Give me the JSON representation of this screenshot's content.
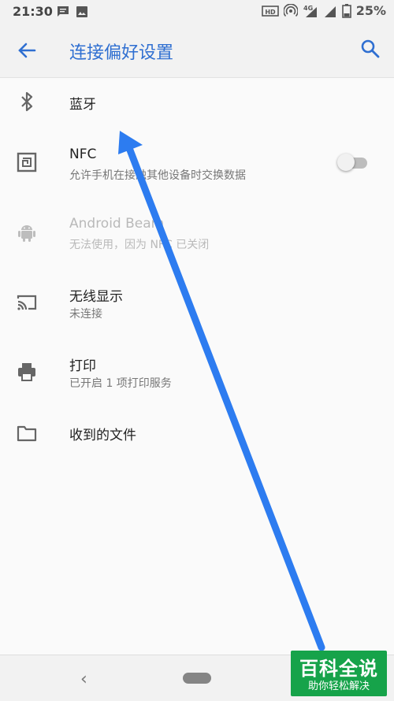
{
  "status_bar": {
    "time": "21:30",
    "left_icons": [
      "message-icon",
      "image-icon"
    ],
    "right_icons": [
      "hd-icon",
      "hotspot-icon",
      "signal-4g-icon",
      "signal-icon",
      "battery-icon"
    ],
    "network": "4G",
    "battery": "25%"
  },
  "app_bar": {
    "title": "连接偏好设置",
    "back_icon": "arrow-back-icon",
    "search_icon": "search-icon"
  },
  "items": [
    {
      "icon": "bluetooth-icon",
      "title": "蓝牙",
      "subtitle": ""
    },
    {
      "icon": "nfc-icon",
      "title": "NFC",
      "subtitle": "允许手机在接触其他设备时交换数据",
      "toggle": false
    },
    {
      "icon": "android-icon",
      "title": "Android Beam",
      "subtitle": "无法使用，因为 NFC 已关闭",
      "disabled": true
    },
    {
      "icon": "cast-icon",
      "title": "无线显示",
      "subtitle": "未连接"
    },
    {
      "icon": "printer-icon",
      "title": "打印",
      "subtitle": "已开启 1 项打印服务"
    },
    {
      "icon": "folder-icon",
      "title": "收到的文件",
      "subtitle": ""
    }
  ],
  "nav_bar": {
    "back": "‹",
    "home_icon": "home-pill-icon"
  },
  "watermark": {
    "title": "百科全说",
    "subtitle": "助你轻松解决"
  },
  "colors": {
    "accent": "#2f6fd1",
    "annotation_arrow": "#2d7cf0",
    "watermark": "#16a34a"
  }
}
